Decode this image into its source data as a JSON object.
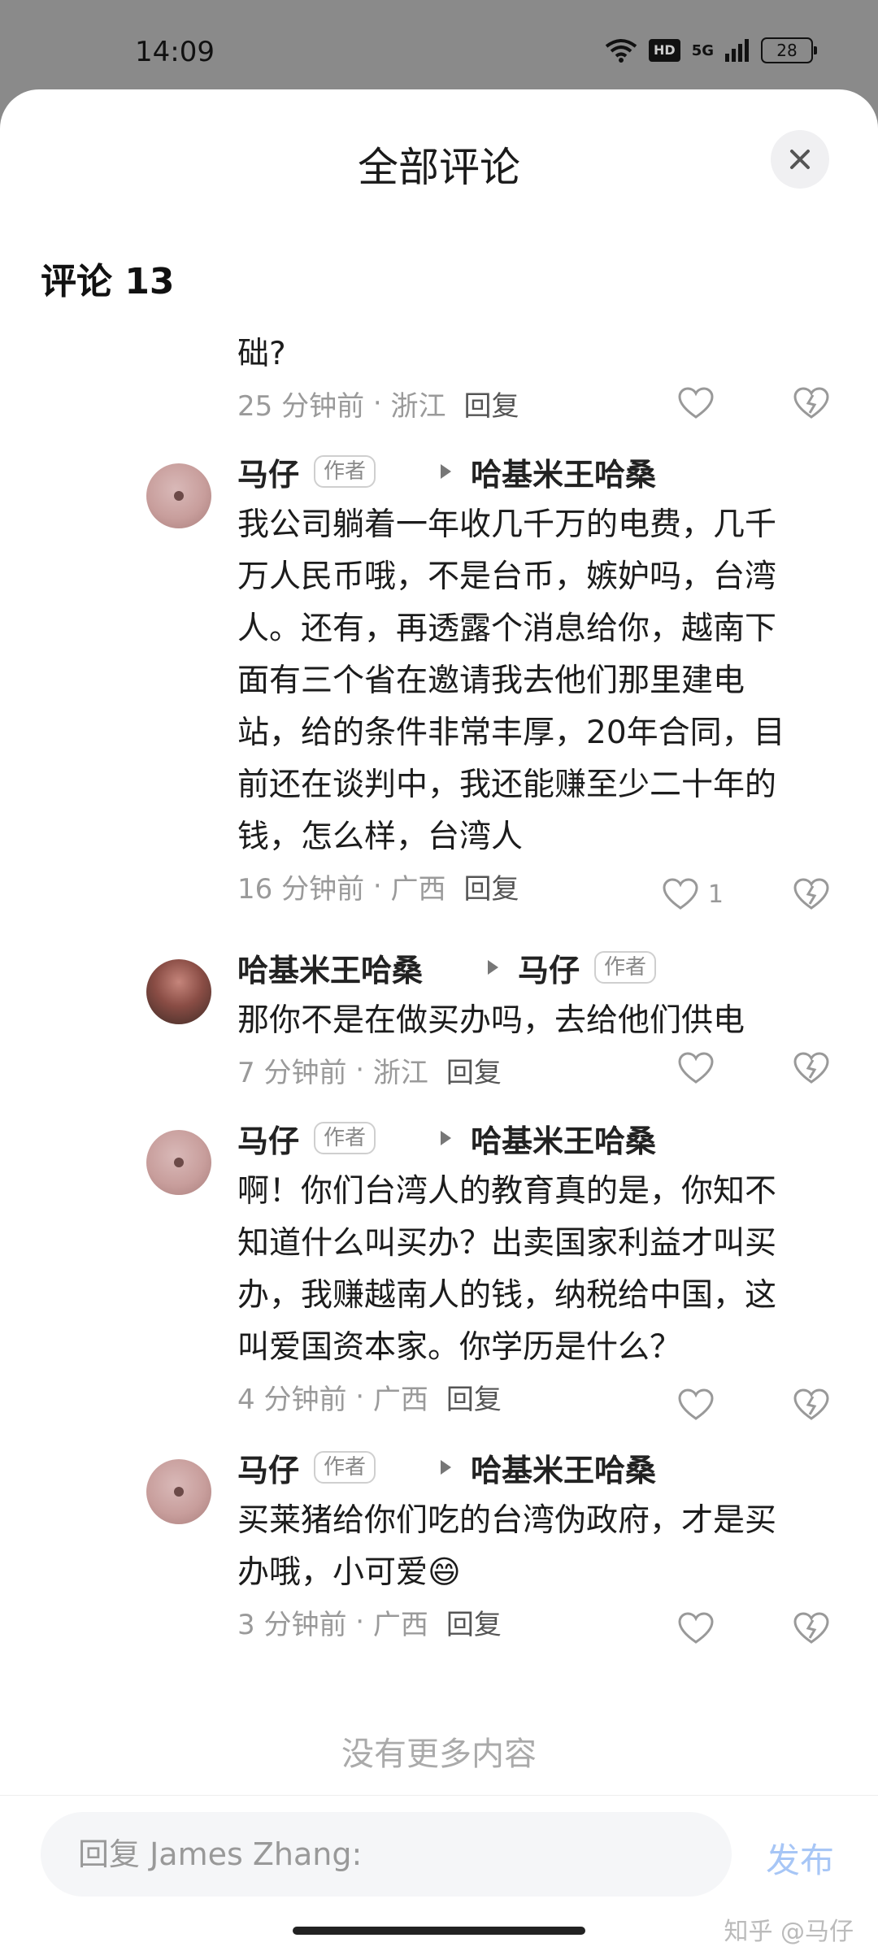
{
  "status_bar": {
    "time": "14:09",
    "hd": "HD",
    "network": "5G",
    "battery": "28"
  },
  "sheet": {
    "title": "全部评论",
    "comment_count_label": "评论 13"
  },
  "comments": [
    {
      "text": "础?",
      "time": "25 分钟前",
      "region": "浙江",
      "reply_label": "回复",
      "likes": ""
    },
    {
      "author": "马仔",
      "author_tag": "作者",
      "reply_to": "哈基米王哈桑",
      "text": "我公司躺着一年收几千万的电费，几千\n万人民币哦，不是台币，嫉妒吗，台湾\n人。还有，再透露个消息给你，越南下\n面有三个省在邀请我去他们那里建电\n站，给的条件非常丰厚，20年合同，目\n前还在谈判中，我还能赚至少二十年的\n钱，怎么样，台湾人",
      "time": "16 分钟前",
      "region": "广西",
      "reply_label": "回复",
      "likes": "1"
    },
    {
      "author": "哈基米王哈桑",
      "reply_to": "马仔",
      "reply_to_tag": "作者",
      "text": "那你不是在做买办吗，去给他们供电",
      "time": "7 分钟前",
      "region": "浙江",
      "reply_label": "回复",
      "likes": ""
    },
    {
      "author": "马仔",
      "author_tag": "作者",
      "reply_to": "哈基米王哈桑",
      "text": "啊！你们台湾人的教育真的是，你知不\n知道什么叫买办？出卖国家利益才叫买\n办，我赚越南人的钱，纳税给中国，这\n叫爱国资本家。你学历是什么？",
      "time": "4 分钟前",
      "region": "广西",
      "reply_label": "回复",
      "likes": ""
    },
    {
      "author": "马仔",
      "author_tag": "作者",
      "reply_to": "哈基米王哈桑",
      "text": "买莱猪给你们吃的台湾伪政府，才是买\n办哦，小可爱😄",
      "time": "3 分钟前",
      "region": "广西",
      "reply_label": "回复",
      "likes": ""
    }
  ],
  "footer": {
    "no_more": "没有更多内容",
    "reply_placeholder": "回复 James Zhang:",
    "publish_label": "发布",
    "watermark": "知乎 @马仔"
  },
  "icons": {
    "close": "close-icon",
    "like": "heart-icon",
    "dislike": "broken-heart-icon",
    "reply_arrow": "reply-arrow-icon"
  }
}
